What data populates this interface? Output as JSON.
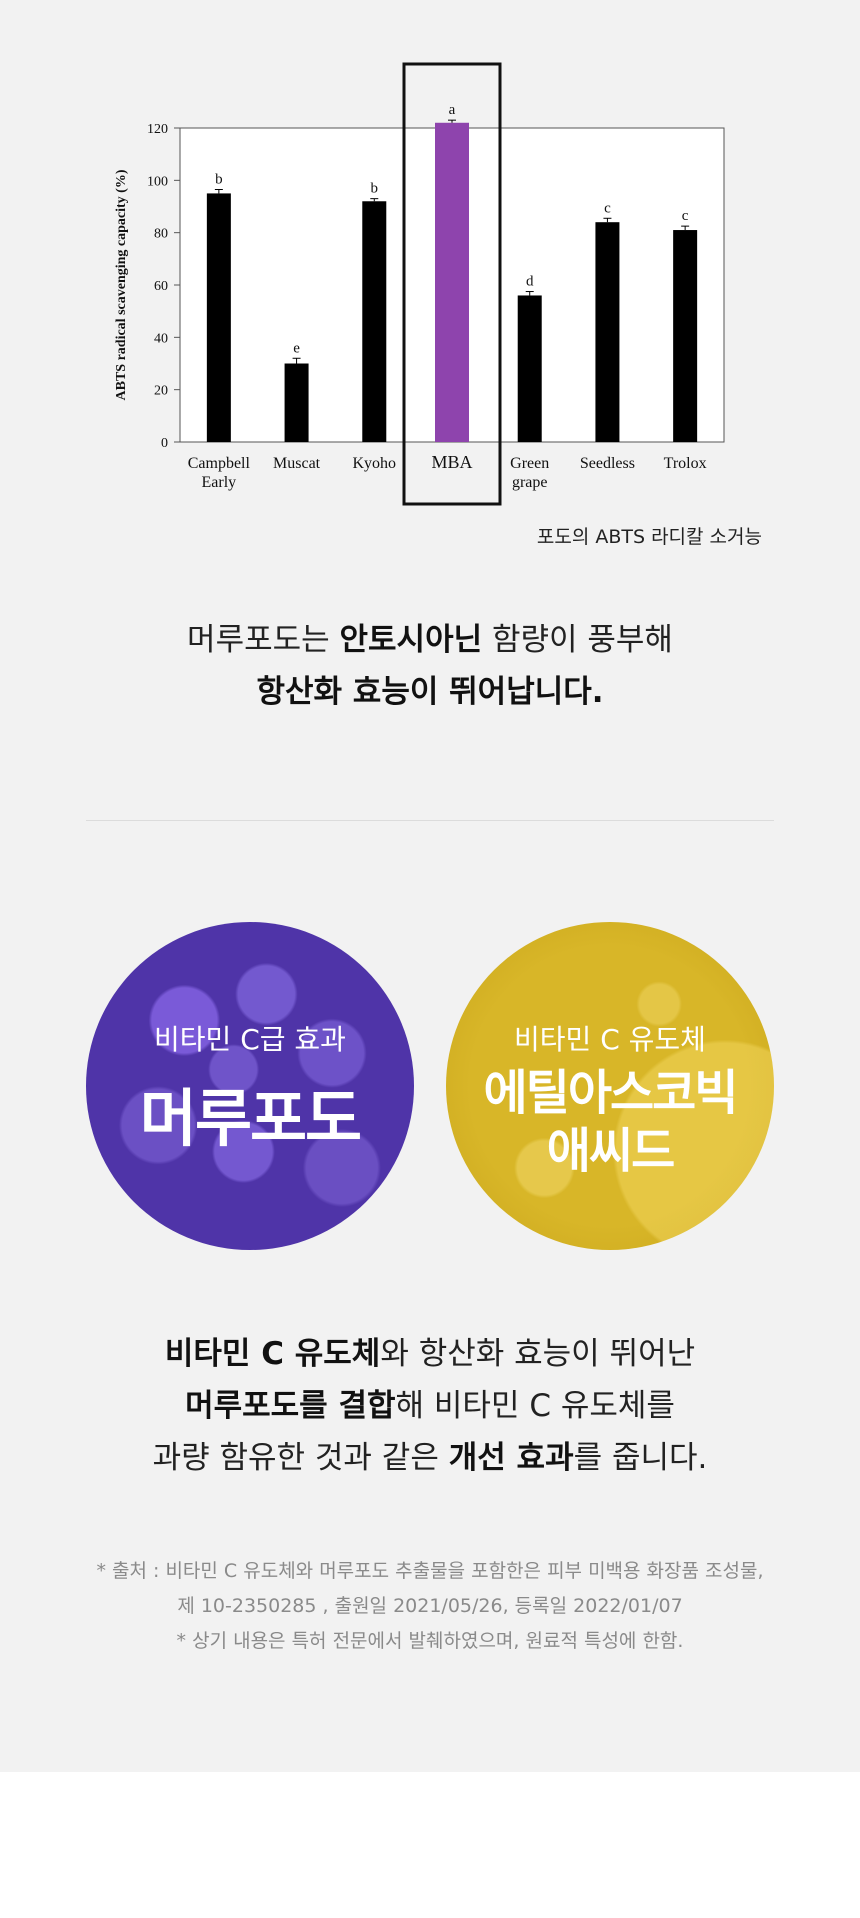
{
  "chart_data": {
    "type": "bar",
    "categories": [
      "Campbell Early",
      "Muscat",
      "Kyoho",
      "MBA",
      "Green grape",
      "Seedless",
      "Trolox"
    ],
    "category_lines": [
      [
        "Campbell",
        "Early"
      ],
      [
        "Muscat"
      ],
      [
        "Kyoho"
      ],
      [
        "MBA"
      ],
      [
        "Green",
        "grape"
      ],
      [
        "Seedless"
      ],
      [
        "Trolox"
      ]
    ],
    "values": [
      95,
      30,
      92,
      122,
      56,
      84,
      81
    ],
    "errors": [
      1.5,
      2,
      1,
      1,
      1.5,
      1.5,
      1.5
    ],
    "letters": [
      "b",
      "e",
      "b",
      "a",
      "d",
      "c",
      "c"
    ],
    "highlight_index": 3,
    "bar_color": "#000000",
    "highlight_color": "#8e44ad",
    "ylabel": "ABTS radical scavenging capacity (%)",
    "ylim": [
      0,
      120
    ],
    "yticks": [
      0,
      20,
      40,
      60,
      80,
      100,
      120
    ],
    "grid": false
  },
  "chart_caption": "포도의 ABTS 라디칼 소거능",
  "headline1": {
    "line1_pre": "머루포도는 ",
    "line1_bold": "안토시아닌",
    "line1_post": " 함량이 풍부해",
    "line2_bold": "항산화 효능이 뛰어납니다."
  },
  "circles": {
    "grape": {
      "sub": "비타민 C급 효과",
      "main": "머루포도",
      "color": "#4f34a8"
    },
    "gold": {
      "sub": "비타민 C 유도체",
      "main_line1": "에틸아스코빅",
      "main_line2": "애씨드",
      "color": "#d4b020"
    }
  },
  "headline2": {
    "l1_bold": "비타민 C 유도체",
    "l1_post": "와 항산화 효능이 뛰어난",
    "l2_bold": "머루포도를 결합",
    "l2_post": "해 비타민 C 유도체를",
    "l3_pre": "과량 함유한 것과 같은 ",
    "l3_bold": "개선 효과",
    "l3_post": "를 줍니다."
  },
  "footnote": {
    "line1": "* 출처 : 비타민 C 유도체와 머루포도 추출물을 포함한은 피부 미백용 화장품 조성물,",
    "line2": "제 10-2350285 , 출원일 2021/05/26, 등록일 2022/01/07",
    "line3": "* 상기 내용은 특허 전문에서 발췌하였으며, 원료적 특성에 한함."
  }
}
